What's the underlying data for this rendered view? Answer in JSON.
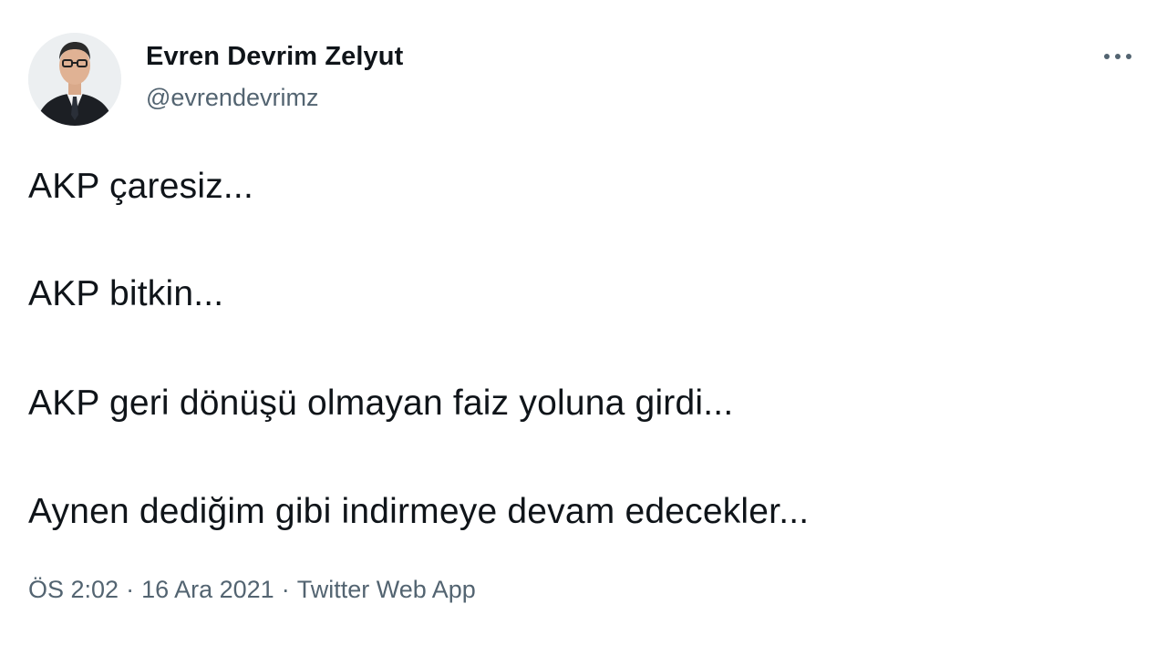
{
  "author": {
    "display_name": "Evren Devrim Zelyut",
    "handle": "@evrendevrimz",
    "avatar_icon": "person-portrait-icon"
  },
  "more_icon": "more-options-icon",
  "tweet": {
    "lines": [
      "AKP çaresiz...",
      "AKP bitkin...",
      "AKP geri dönüşü olmayan faiz yoluna girdi...",
      "Aynen dediğim gibi indirmeye devam edecekler..."
    ]
  },
  "meta": {
    "time": "ÖS 2:02",
    "separator": "·",
    "date": "16 Ara 2021",
    "source": "Twitter Web App"
  },
  "colors": {
    "text_primary": "#0f1419",
    "text_secondary": "#536471",
    "background": "#ffffff"
  }
}
